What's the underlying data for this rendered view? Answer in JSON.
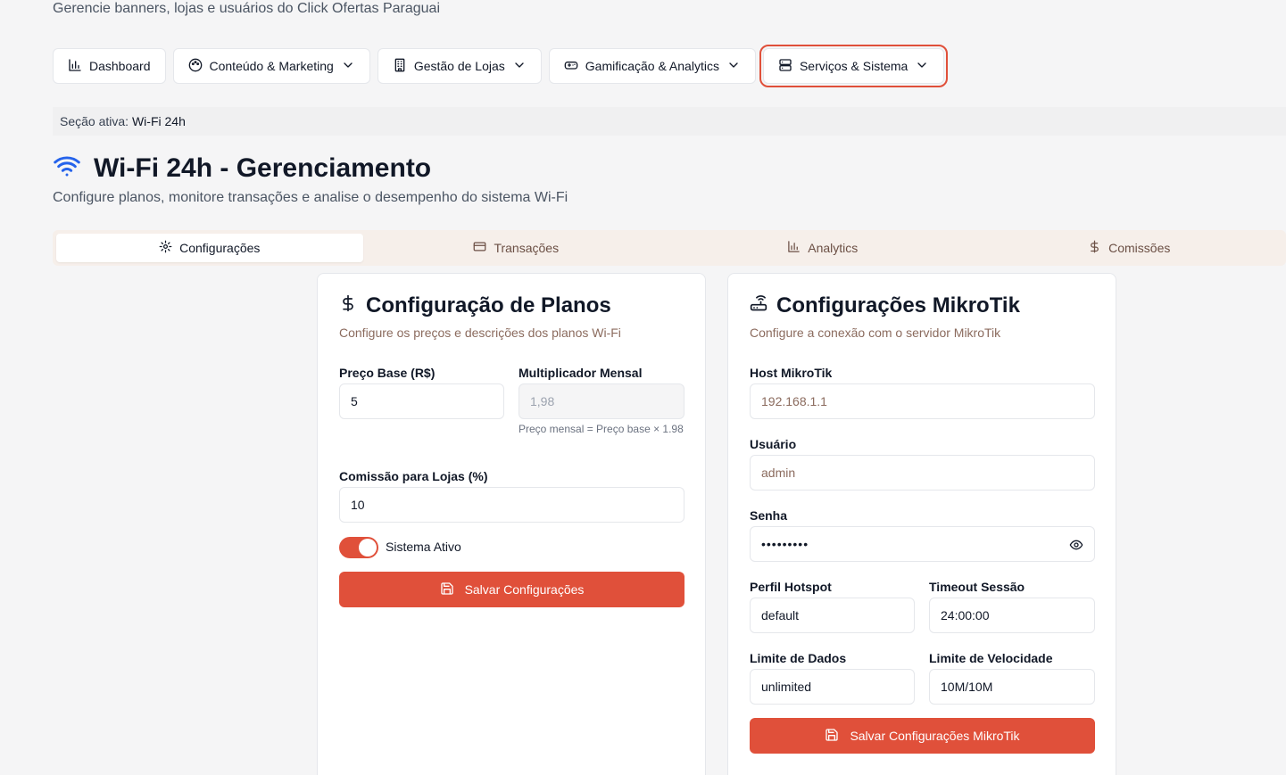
{
  "header": {
    "subtitle": "Gerencie banners, lojas e usuários do Click Ofertas Paraguai"
  },
  "nav": {
    "dashboard": "Dashboard",
    "content": "Conteúdo & Marketing",
    "stores": "Gestão de Lojas",
    "gamification": "Gamificação & Analytics",
    "services": "Serviços & Sistema"
  },
  "section": {
    "label": "Seção ativa:",
    "value": "Wi-Fi 24h"
  },
  "page": {
    "title": "Wi-Fi 24h - Gerenciamento",
    "description": "Configure planos, monitore transações e analise o desempenho do sistema Wi-Fi"
  },
  "tabs": {
    "config": "Configurações",
    "transactions": "Transações",
    "analytics": "Analytics",
    "commissions": "Comissões"
  },
  "plans": {
    "title": "Configuração de Planos",
    "description": "Configure os preços e descrições dos planos Wi-Fi",
    "base_price_label": "Preço Base (R$)",
    "base_price_value": "5",
    "multiplier_label": "Multiplicador Mensal",
    "multiplier_value": "1,98",
    "multiplier_help": "Preço mensal = Preço base × 1.98",
    "commission_label": "Comissão para Lojas (%)",
    "commission_value": "10",
    "active_label": "Sistema Ativo",
    "active": true,
    "save_label": "Salvar Configurações"
  },
  "mikrotik": {
    "title": "Configurações MikroTik",
    "description": "Configure a conexão com o servidor MikroTik",
    "host_label": "Host MikroTik",
    "host_value": "192.168.1.1",
    "user_label": "Usuário",
    "user_value": "admin",
    "password_label": "Senha",
    "password_value": "•••••••••",
    "profile_label": "Perfil Hotspot",
    "profile_value": "default",
    "timeout_label": "Timeout Sessão",
    "timeout_value": "24:00:00",
    "data_limit_label": "Limite de Dados",
    "data_limit_value": "unlimited",
    "speed_limit_label": "Limite de Velocidade",
    "speed_limit_value": "10M/10M",
    "save_label": "Salvar Configurações MikroTik"
  },
  "colors": {
    "accent": "#e0503a",
    "wifi_icon": "#2563eb"
  }
}
